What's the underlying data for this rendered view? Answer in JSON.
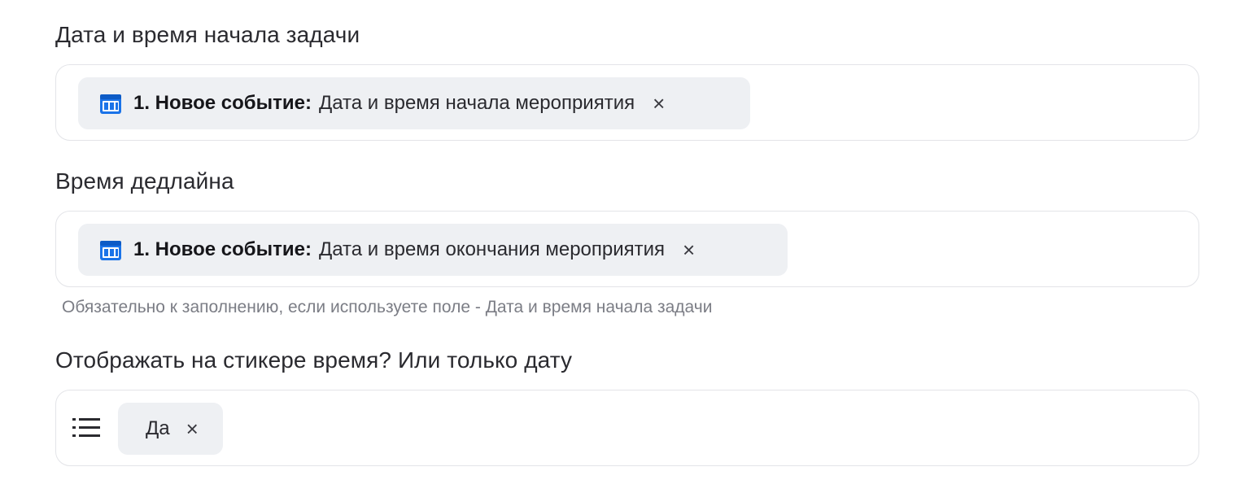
{
  "fields": {
    "start": {
      "label": "Дата и время начала задачи",
      "chip_source": "1. Новое событие:",
      "chip_text": "Дата и время начала мероприятия",
      "chip_close": "×",
      "chip_icon": "calendar-icon"
    },
    "deadline": {
      "label": "Время дедлайна",
      "chip_source": "1. Новое событие:",
      "chip_text": "Дата и время окончания мероприятия",
      "chip_close": "×",
      "chip_icon": "calendar-icon",
      "hint": "Обязательно к заполнению, если используете поле - Дата и время начала задачи"
    },
    "show_time": {
      "label": "Отображать на стикере время? Или только дату",
      "list_icon": "list-icon",
      "chip_text": "Да",
      "chip_close": "×"
    }
  },
  "colors": {
    "chip_bg": "#eef0f3",
    "border": "#e3e4e8",
    "calendar_icon": "#1a73e8"
  }
}
